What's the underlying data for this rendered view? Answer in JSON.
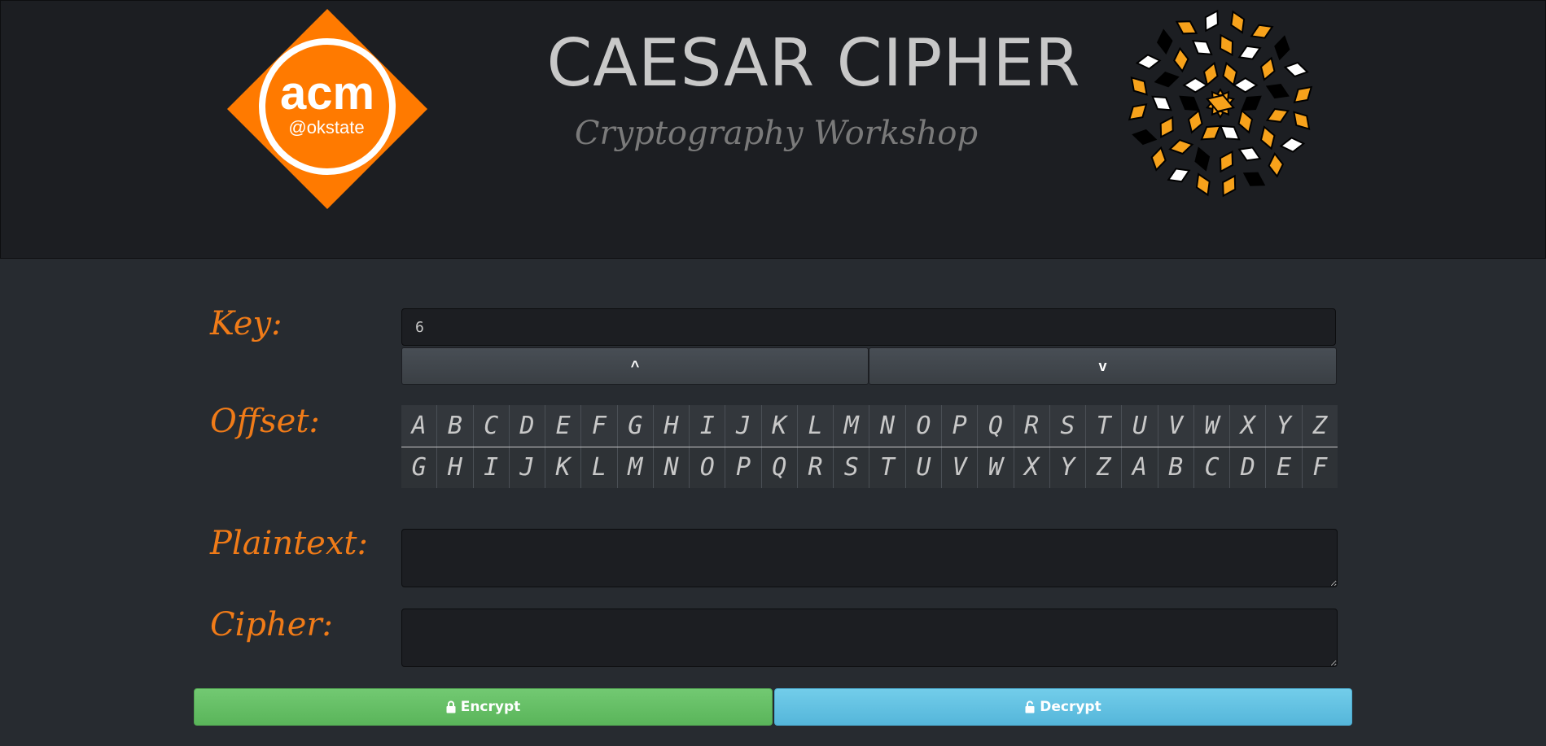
{
  "header": {
    "title": "CAESAR CIPHER",
    "subtitle": "Cryptography Workshop",
    "logo_left": {
      "main_text": "acm",
      "sub_text": "@okstate",
      "color": "#ff7a00"
    },
    "logo_right": {
      "icon": "penrose-tiling-icon",
      "colors": [
        "#f7a21b",
        "#ffffff",
        "#000000"
      ]
    }
  },
  "key": {
    "label": "Key:",
    "value": "6",
    "up_label": "^",
    "down_label": "v"
  },
  "offset": {
    "label": "Offset:",
    "plain_row": [
      "A",
      "B",
      "C",
      "D",
      "E",
      "F",
      "G",
      "H",
      "I",
      "J",
      "K",
      "L",
      "M",
      "N",
      "O",
      "P",
      "Q",
      "R",
      "S",
      "T",
      "U",
      "V",
      "W",
      "X",
      "Y",
      "Z"
    ],
    "shifted_row": [
      "G",
      "H",
      "I",
      "J",
      "K",
      "L",
      "M",
      "N",
      "O",
      "P",
      "Q",
      "R",
      "S",
      "T",
      "U",
      "V",
      "W",
      "X",
      "Y",
      "Z",
      "A",
      "B",
      "C",
      "D",
      "E",
      "F"
    ]
  },
  "plaintext": {
    "label": "Plaintext:",
    "value": ""
  },
  "cipher": {
    "label": "Cipher:",
    "value": ""
  },
  "actions": {
    "encrypt_label": "Encrypt",
    "decrypt_label": "Decrypt",
    "encrypt_color": "#5cb85c",
    "decrypt_color": "#5bc0de"
  },
  "colors": {
    "accent": "#f07b18",
    "background": "#272b30",
    "header_bg": "#1c1e22"
  }
}
